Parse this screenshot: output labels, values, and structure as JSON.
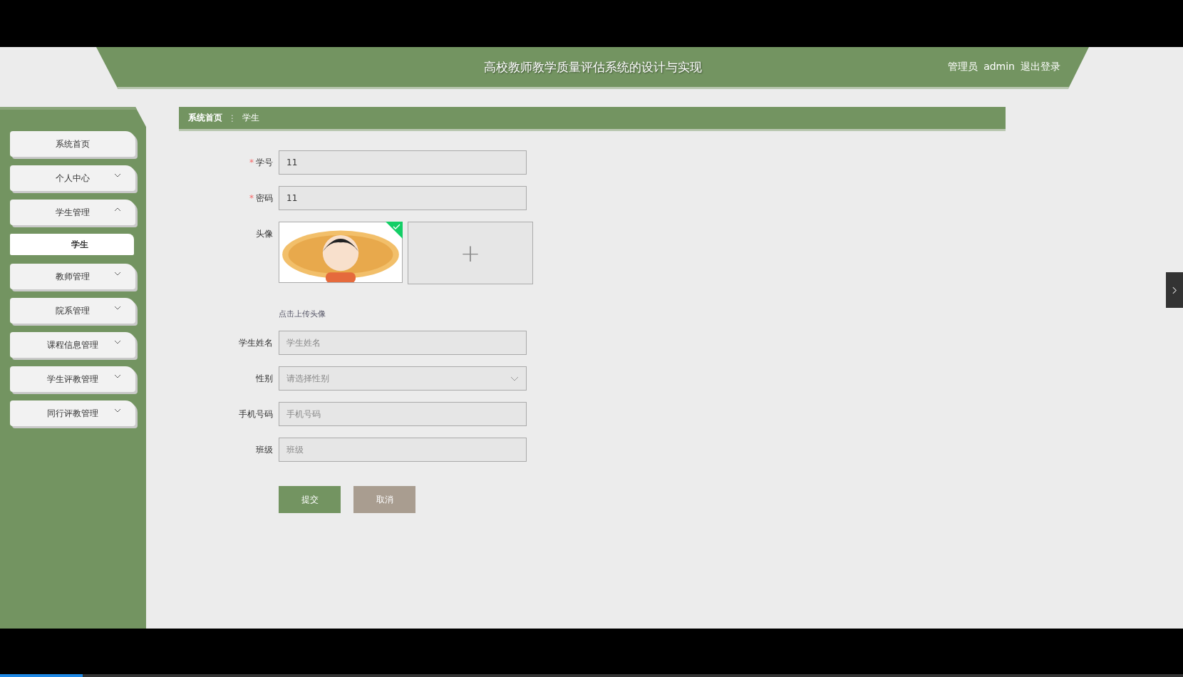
{
  "header": {
    "title": "高校教师教学质量评估系统的设计与实现",
    "role": "管理员",
    "user": "admin",
    "logout": "退出登录"
  },
  "sidebar": {
    "items": [
      {
        "label": "系统首页",
        "selected": false
      },
      {
        "label": "个人中心",
        "expanded": false,
        "selected": false
      },
      {
        "label": "学生管理",
        "expanded": true,
        "selected": false,
        "children": [
          {
            "label": "学生",
            "selected": true
          }
        ]
      },
      {
        "label": "教师管理",
        "expanded": false,
        "selected": false
      },
      {
        "label": "院系管理",
        "expanded": false,
        "selected": false
      },
      {
        "label": "课程信息管理",
        "expanded": false,
        "selected": false
      },
      {
        "label": "学生评教管理",
        "expanded": false,
        "selected": false
      },
      {
        "label": "同行评教管理",
        "expanded": false,
        "selected": false
      }
    ]
  },
  "breadcrumb": [
    "系统首页",
    "学生"
  ],
  "breadcrumb_separator": "⋮",
  "required_mark": "*",
  "form": {
    "fields": [
      {
        "kind": "input",
        "label": "学号",
        "required": true,
        "value": "11"
      },
      {
        "kind": "input",
        "label": "密码",
        "required": true,
        "value": "11"
      },
      {
        "label": "头像",
        "required": false,
        "uploaded": true,
        "upload_symbol": "+",
        "hint": "点击上传头像"
      },
      {
        "kind": "input",
        "label": "学生姓名",
        "required": false,
        "placeholder": "学生姓名"
      },
      {
        "kind": "select",
        "label": "性别",
        "required": false,
        "placeholder": "请选择性别"
      },
      {
        "kind": "input",
        "label": "手机号码",
        "required": false,
        "placeholder": "手机号码"
      },
      {
        "kind": "input",
        "label": "班级",
        "required": false,
        "placeholder": "班级"
      }
    ],
    "buttons": [
      {
        "kind": "primary",
        "label": "提交"
      },
      {
        "kind": "secondary",
        "label": "取消"
      }
    ]
  },
  "video_progress": {
    "level": 0.07
  }
}
